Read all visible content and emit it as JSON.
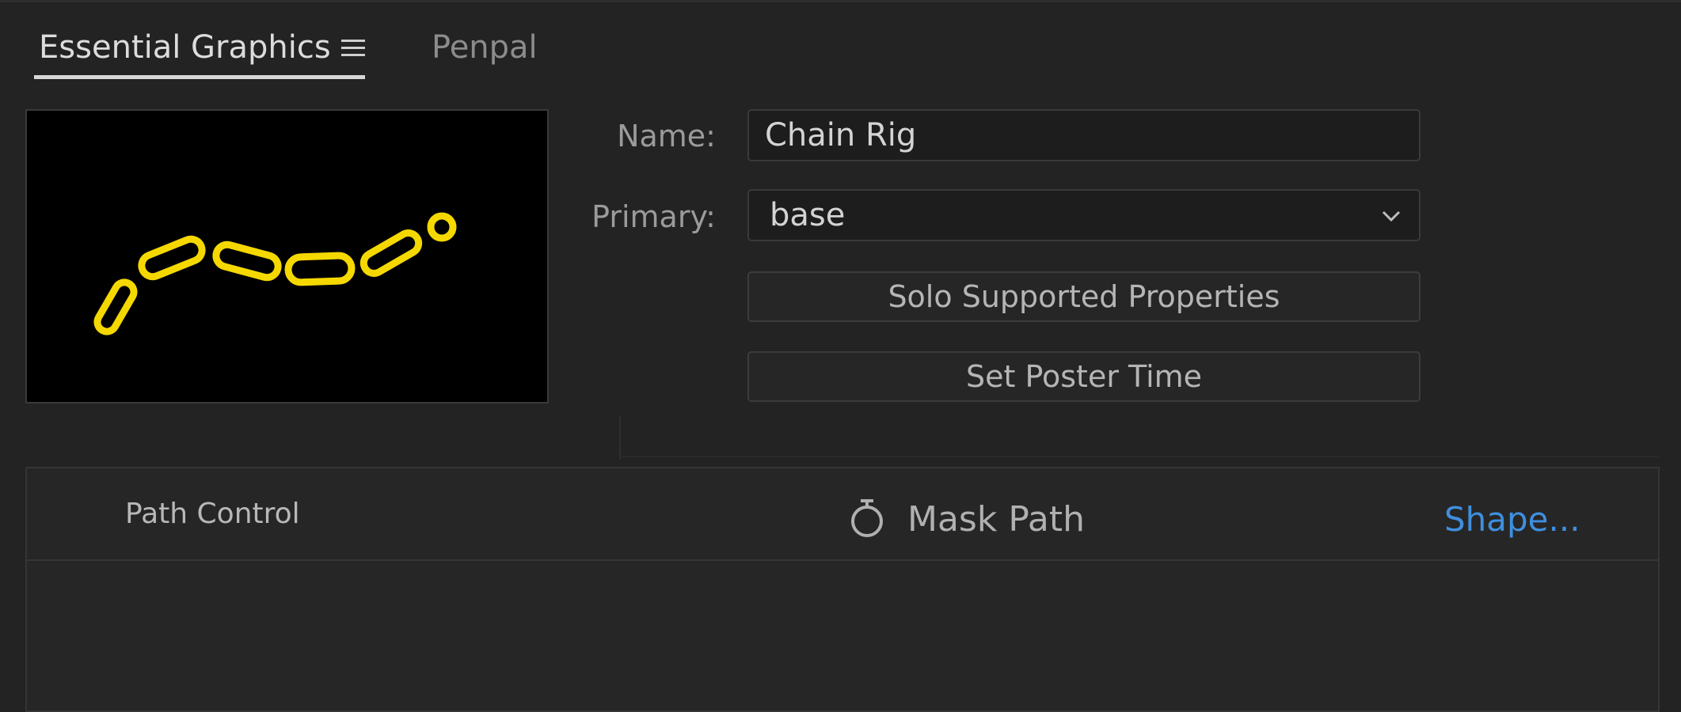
{
  "tabs": {
    "active_label": "Essential Graphics",
    "inactive_label": "Penpal"
  },
  "icons": {
    "tab_menu": "hamburger-menu-icon",
    "dropdown": "chevron-down-icon",
    "stopwatch": "stopwatch-icon"
  },
  "thumbnail": {
    "description_color": "#f5d800"
  },
  "form": {
    "name_label": "Name:",
    "name_value": "Chain Rig",
    "primary_label": "Primary:",
    "primary_value": "base",
    "solo_button": "Solo Supported Properties",
    "poster_button": "Set Poster Time"
  },
  "properties": [
    {
      "name": "Path Control",
      "parameter": "Mask Path",
      "value": "Shape..."
    }
  ],
  "colors": {
    "background": "#232323",
    "link": "#3f8fde",
    "chain": "#f5d800"
  }
}
